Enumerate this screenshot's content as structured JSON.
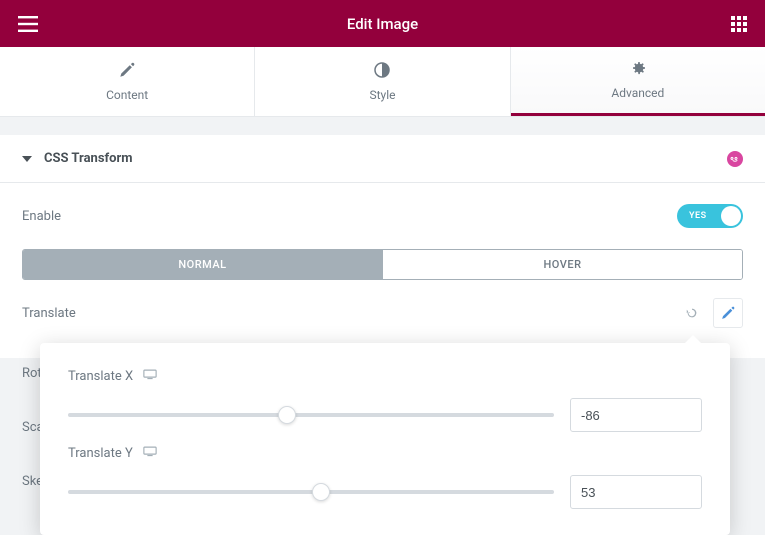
{
  "header": {
    "title": "Edit Image"
  },
  "tabs": [
    {
      "label": "Content"
    },
    {
      "label": "Style"
    },
    {
      "label": "Advanced"
    }
  ],
  "section": {
    "title": "CSS Transform"
  },
  "enable": {
    "label": "Enable",
    "toggle_text": "YES"
  },
  "state_tabs": {
    "normal": "NORMAL",
    "hover": "HOVER"
  },
  "translate": {
    "label": "Translate"
  },
  "rotate": {
    "label": "Rotate"
  },
  "scale": {
    "label": "Scale"
  },
  "skew": {
    "label": "Skew"
  },
  "popover": {
    "x_label": "Translate X",
    "x_value": "-86",
    "y_label": "Translate Y",
    "y_value": "53"
  },
  "slider": {
    "x_thumb_percent": 45,
    "y_thumb_percent": 52
  },
  "colors": {
    "primary": "#93003c",
    "toggle_on": "#39c3dd"
  }
}
